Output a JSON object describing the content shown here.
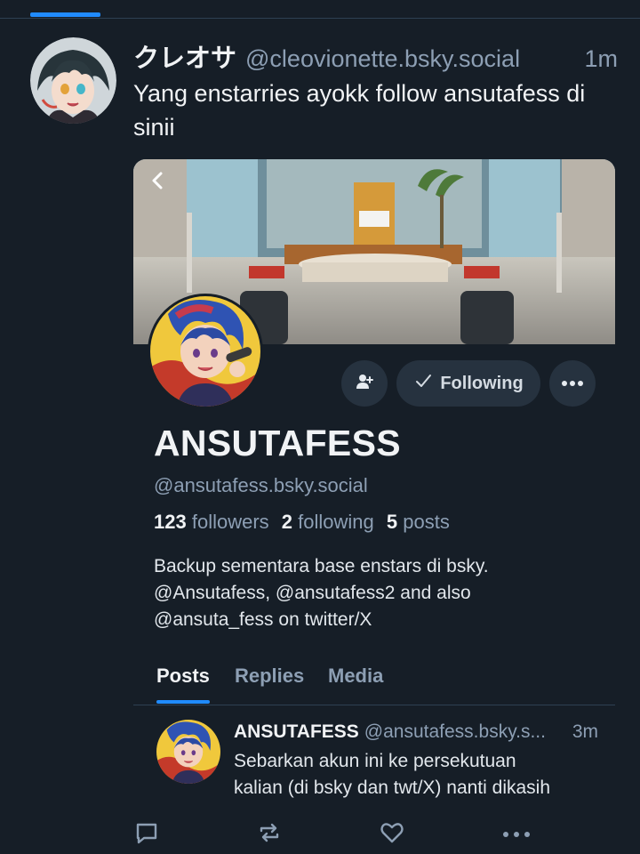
{
  "post": {
    "author_display_name": "クレオサ",
    "author_handle": "@cleovionette.bsky.social",
    "timestamp": "1m",
    "text": "Yang enstarries ayokk follow ansutafess di sinii"
  },
  "profile_card": {
    "name": "ANSUTAFESS",
    "handle": "@ansutafess.bsky.social",
    "stats": {
      "followers_count": "123",
      "followers_label": "followers",
      "following_count": "2",
      "following_label": "following",
      "posts_count": "5",
      "posts_label": "posts"
    },
    "following_button_label": "Following",
    "bio_lines": [
      "Backup sementara base enstars di bsky.",
      "@Ansutafess, @ansutafess2 and also",
      "@ansuta_fess on twitter/X"
    ],
    "tabs": [
      {
        "label": "Posts",
        "active": true
      },
      {
        "label": "Replies",
        "active": false
      },
      {
        "label": "Media",
        "active": false
      }
    ]
  },
  "nested_post": {
    "name": "ANSUTAFESS",
    "handle": "@ansutafess.bsky.s...",
    "timestamp": "3m",
    "text_lines": [
      "Sebarkan akun ini ke persekutuan",
      "kalian (di bsky dan twt/X) nanti dikasih"
    ]
  },
  "icons": {
    "back": "chevron-left-icon",
    "add_user": "person-add-icon",
    "following_check": "check-icon",
    "more": "ellipsis-icon",
    "reply": "comment-icon",
    "repost": "repost-icon",
    "like": "heart-icon",
    "post_more": "ellipsis-icon"
  },
  "colors": {
    "background": "#161e27",
    "accent": "#208bfe",
    "muted_text": "#8d9fb4",
    "button_bg": "#26323f"
  }
}
